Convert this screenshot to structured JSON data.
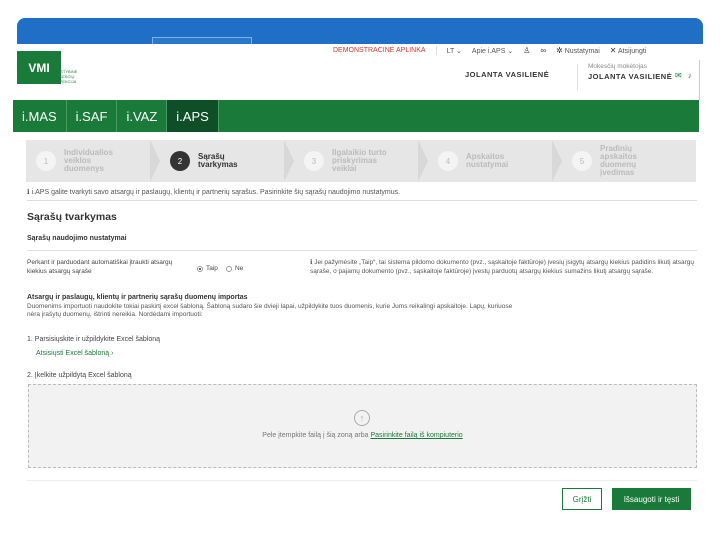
{
  "header": {
    "logo_text": "VMI",
    "logo_subtext": "VALSTYBINĖ MOKESČIŲ INSPEKCIJA",
    "demo_label": "DEMONSTRACINĖ APLINKA",
    "lang": "LT ⌄",
    "about": "Apie i.APS ⌄",
    "settings": "Nustatymai",
    "logout": "Atsijungti",
    "user_name": "JOLANTA VASILIENĖ",
    "payer_label": "Mokesčių mokėtojas",
    "payer_name": "JOLANTA VASILIENĖ"
  },
  "nav": {
    "tabs": [
      {
        "label": "i.MAS"
      },
      {
        "label": "i.SAF"
      },
      {
        "label": "i.VAZ"
      },
      {
        "label": "i.APS"
      }
    ],
    "active_index": 3
  },
  "stepper": {
    "steps": [
      {
        "num": "1",
        "label": "Individualios veiklos duomenys"
      },
      {
        "num": "2",
        "label": "Sąrašų tvarkymas"
      },
      {
        "num": "3",
        "label": "Ilgalaikio turto priskyrimas veiklai"
      },
      {
        "num": "4",
        "label": "Apskaitos nustatymai"
      },
      {
        "num": "5",
        "label": "Pradinių apskaitos duomenų įvedimas"
      }
    ],
    "active_index": 1
  },
  "info_line": "i.APS galite tvarkyti savo atsargų ir paslaugų, klientų ir partnerių sąrašus. Pasirinkite šių sąrašų naudojimo nustatymus.",
  "section_title": "Sąrašų tvarkymas",
  "sub_title": "Sąrašų naudojimo nustatymai",
  "question": "Perkant ir parduodant automatiškai įtraukti atsargų kiekius atsargų sąraše",
  "radio_yes": "Taip",
  "radio_no": "Ne",
  "hint": "Jei pažymėsite „Taip“, tai sistema pildomo dokumento (pvz., sąskaitoje faktūroje) įvesių įsigytų atsargų kiekius padidins likutį atsargų sąraše, o pajamų dokumento (pvz., sąskaitoje faktūroje) įvestų parduotų atsargų kiekius sumažins likutį atsargų sąraše.",
  "import_title": "Atsargų ir paslaugų, klientų ir partnerių sąrašų duomenų importas",
  "import_desc": "Duomenims importuoti naudokite tokiai paskirtį excel šabloną. Šabloną sudaro šie dvieji lapai, užpildykite tuos duomenis, kurie Jums reikalingi apskaitoje. Lapų, kuriuose nėra įrašytų duomenų, ištrinti nereikia. Nordėdami importuoti:",
  "step1_label": "1. Parsisiųskite ir užpildykite Excel šabloną",
  "download_link": "Atsisiųsti Excel šabloną  ›",
  "step2_label": "2. Įkelkite užpildytą Excel šabloną",
  "drop_text": "Pele įtempkite failą į šią zoną arba",
  "drop_link": "Pasirinkite failą iš kompiuterio",
  "buttons": {
    "back": "Grįžti",
    "save": "Išsaugoti ir tęsti"
  }
}
